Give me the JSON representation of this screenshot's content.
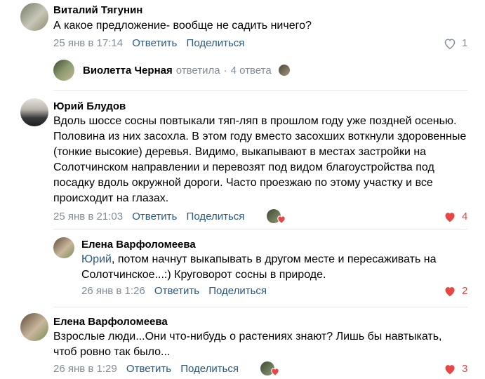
{
  "comments": [
    {
      "author": "Виталий Тягунин",
      "text": "А какое предложение- вообще не садить ничего?",
      "time": "25 янв в 17:14",
      "reply": "Ответить",
      "share": "Поделиться",
      "likes": "1",
      "thread": {
        "author": "Виолетта Черная",
        "action": "ответила",
        "count": "4 ответа"
      }
    },
    {
      "author": "Юрий Блудов",
      "text": "Вдоль шоссе сосны повтыкали тяп-ляп в прошлом году уже поздней осенью. Половина из них засохла. В этом году вместо засохших воткнули здоровенные (тонкие высокие) деревья. Видимо, выкапывают в местах застройки на Солотчинском направлении и перевозят под видом благоустройства под посадку вдоль окружной дороги. Часто проезжаю по этому участку и все происходит на глазах.",
      "time": "25 янв в 21:03",
      "reply": "Ответить",
      "share": "Поделиться",
      "likes": "4"
    },
    {
      "author": "Елена Варфоломеева",
      "mention": "Юрий",
      "text": ", потом начнут выкапывать в другом месте и пересаживать на Солотчинское...:) Круговорот сосны в природе.",
      "time": "26 янв в 1:26",
      "reply": "Ответить",
      "share": "Поделиться",
      "likes": "2"
    },
    {
      "author": "Елена Варфоломеева",
      "text": "Взрослые люди...Они что-нибудь о растениях знают? Лишь бы навтыкать, чтоб ровно так было...",
      "time": "26 янв в 1:29",
      "reply": "Ответить",
      "share": "Поделиться",
      "likes": "3"
    }
  ],
  "colors": {
    "link": "#2a5885",
    "meta": "#818c99",
    "like_active": "#e64646"
  },
  "icons": {
    "like": "heart-icon"
  }
}
